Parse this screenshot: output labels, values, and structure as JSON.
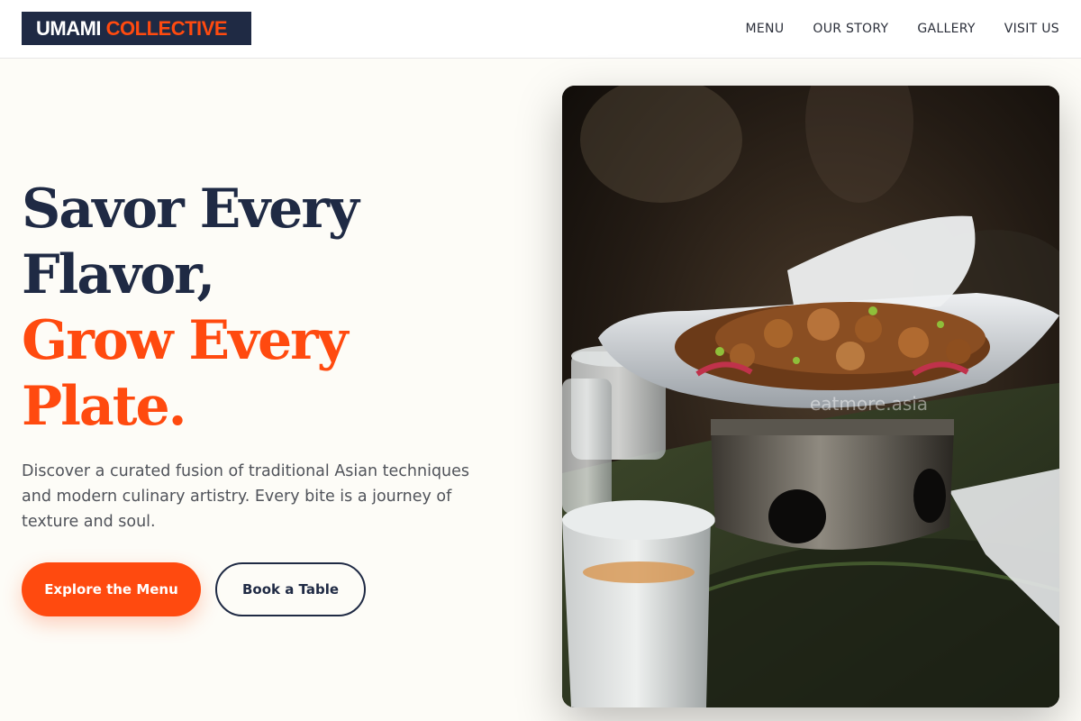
{
  "brand": {
    "name_part1": "UMAMI",
    "name_part2": "COLLECTIVE",
    "primary_color": "#1f2a44",
    "accent_color": "#ff4a0f"
  },
  "nav": {
    "items": [
      {
        "label": "MENU"
      },
      {
        "label": "OUR STORY"
      },
      {
        "label": "GALLERY"
      },
      {
        "label": "VISIT US"
      }
    ]
  },
  "hero": {
    "headline_line1": "Savor Every",
    "headline_line2": "Flavor,",
    "headline_line3": "Grow Every",
    "headline_line4": "Plate.",
    "description": "Discover a curated fusion of traditional Asian techniques and modern culinary artistry. Every bite is a journey of texture and soul.",
    "primary_cta": "Explore the Menu",
    "secondary_cta": "Book a Table",
    "image_subject": "stir-fried dish in white bowl on metal warmer",
    "image_watermark": "eatmore.asia"
  }
}
